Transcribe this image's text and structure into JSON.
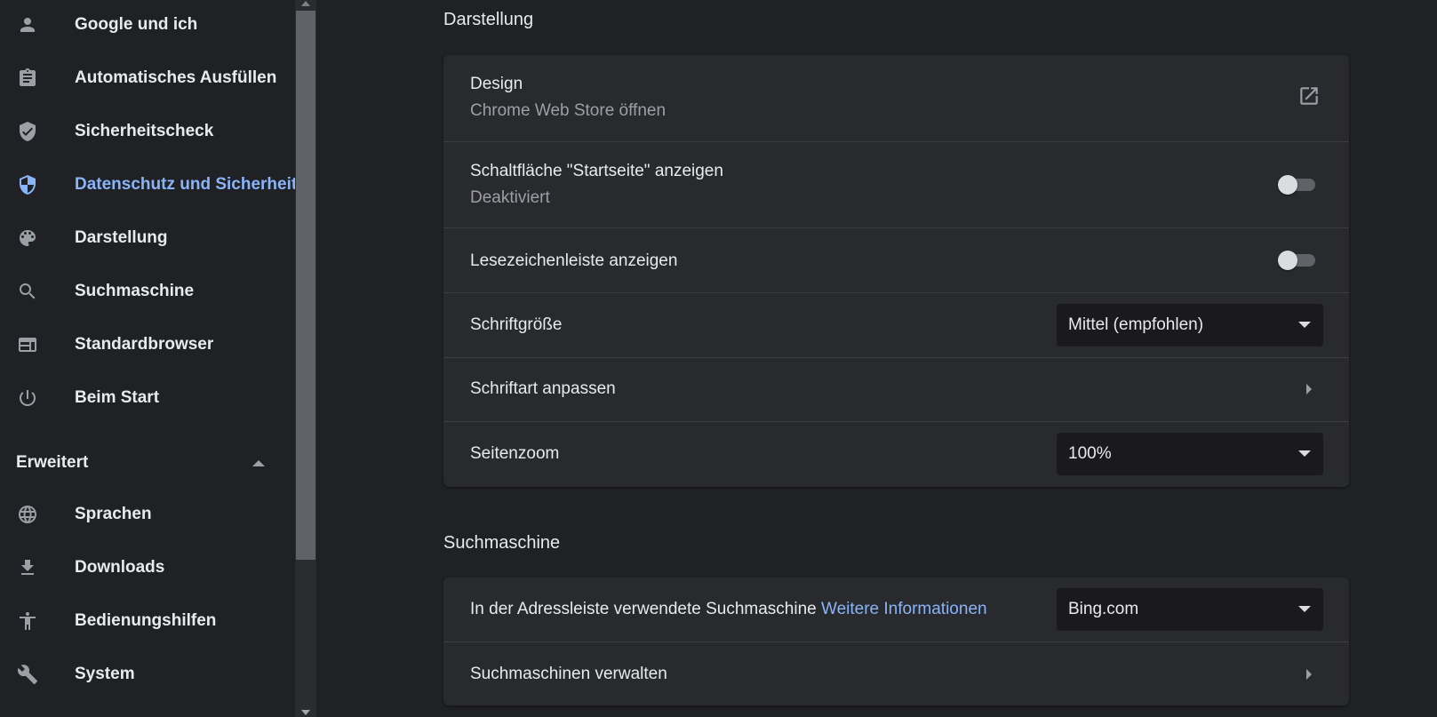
{
  "sidebar": {
    "items": [
      {
        "label": "Google und ich",
        "icon": "person-icon"
      },
      {
        "label": "Automatisches Ausfüllen",
        "icon": "clipboard-icon"
      },
      {
        "label": "Sicherheitscheck",
        "icon": "shield-check-icon"
      },
      {
        "label": "Datenschutz und Sicherheit",
        "icon": "shield-half-icon",
        "active": true
      },
      {
        "label": "Darstellung",
        "icon": "palette-icon"
      },
      {
        "label": "Suchmaschine",
        "icon": "search-icon"
      },
      {
        "label": "Standardbrowser",
        "icon": "browser-window-icon"
      },
      {
        "label": "Beim Start",
        "icon": "power-icon"
      }
    ],
    "advanced": {
      "label": "Erweitert",
      "expanded": true
    },
    "advanced_items": [
      {
        "label": "Sprachen",
        "icon": "globe-icon"
      },
      {
        "label": "Downloads",
        "icon": "download-icon"
      },
      {
        "label": "Bedienungshilfen",
        "icon": "accessibility-icon"
      },
      {
        "label": "System",
        "icon": "wrench-icon"
      }
    ]
  },
  "appearance": {
    "title": "Darstellung",
    "design": {
      "title": "Design",
      "subtitle": "Chrome Web Store öffnen"
    },
    "home_button": {
      "title": "Schaltfläche \"Startseite\" anzeigen",
      "subtitle": "Deaktiviert",
      "enabled": false
    },
    "bookmarks_bar": {
      "title": "Lesezeichenleiste anzeigen",
      "enabled": false
    },
    "font_size": {
      "title": "Schriftgröße",
      "value": "Mittel (empfohlen)"
    },
    "customize_fonts": {
      "title": "Schriftart anpassen"
    },
    "page_zoom": {
      "title": "Seitenzoom",
      "value": "100%"
    }
  },
  "search_engine": {
    "title": "Suchmaschine",
    "address_bar": {
      "title": "In der Adressleiste verwendete Suchmaschine",
      "link": "Weitere Informationen",
      "value": "Bing.com"
    },
    "manage": {
      "title": "Suchmaschinen verwalten"
    }
  },
  "colors": {
    "background": "#202124",
    "card": "#292a2d",
    "accent": "#8ab4f8"
  }
}
